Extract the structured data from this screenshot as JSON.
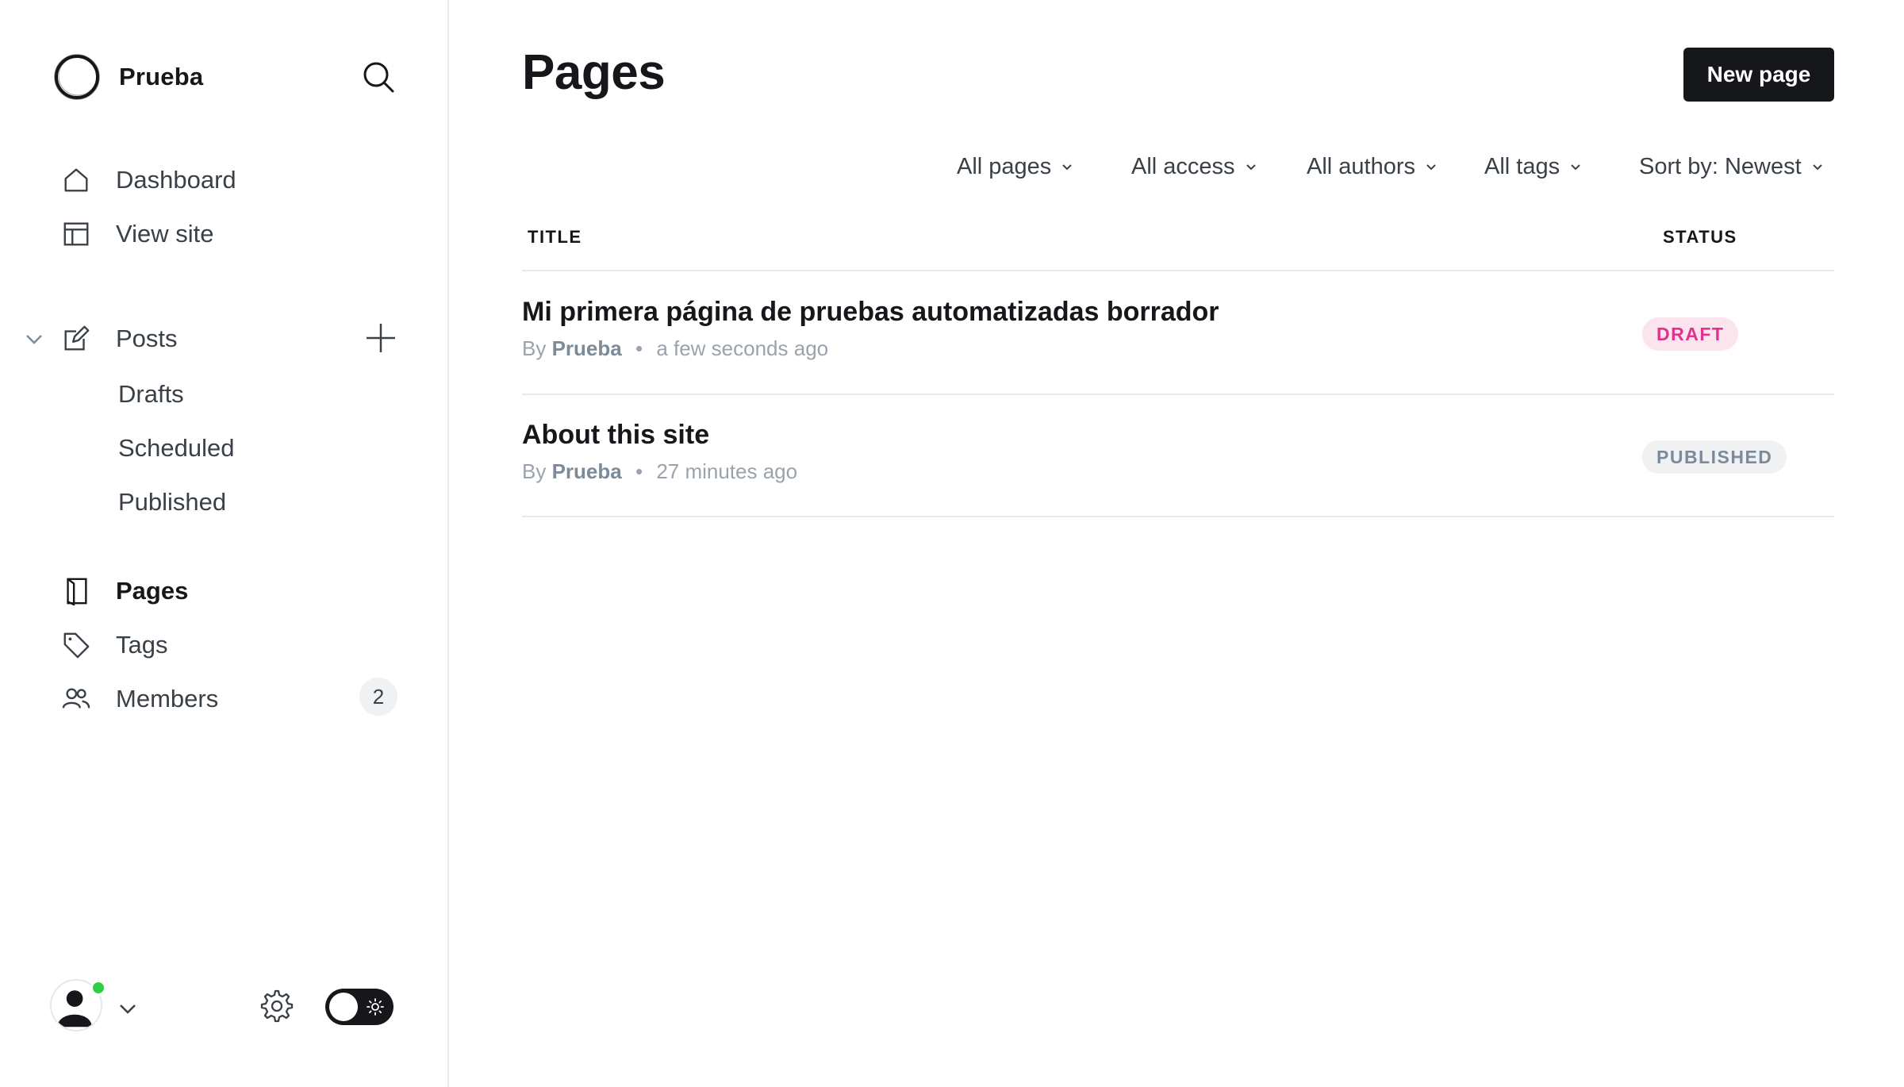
{
  "sidebar": {
    "brand": {
      "name": "Prueba"
    },
    "nav_top": [
      {
        "label": "Dashboard",
        "icon": "home-icon"
      },
      {
        "label": "View site",
        "icon": "layout-icon"
      }
    ],
    "posts": {
      "label": "Posts",
      "icon": "edit-icon",
      "sub_items": [
        {
          "label": "Drafts"
        },
        {
          "label": "Scheduled"
        },
        {
          "label": "Published"
        }
      ]
    },
    "nav_bottom": [
      {
        "label": "Pages",
        "icon": "page-icon",
        "active": true
      },
      {
        "label": "Tags",
        "icon": "tag-icon"
      },
      {
        "label": "Members",
        "icon": "members-icon",
        "count": "2"
      }
    ],
    "footer": {
      "status_color": "#30cf43",
      "theme_toggle_state": "dark"
    }
  },
  "main": {
    "title": "Pages",
    "new_button": "New page",
    "filters": [
      {
        "label": "All pages"
      },
      {
        "label": "All access"
      },
      {
        "label": "All authors"
      },
      {
        "label": "All tags"
      },
      {
        "label": "Sort by: Newest"
      }
    ],
    "columns": {
      "title": "TITLE",
      "status": "STATUS"
    },
    "rows": [
      {
        "title": "Mi primera página de pruebas automatizadas borrador",
        "by": "By",
        "author": "Prueba",
        "separator": "•",
        "time": "a few seconds ago",
        "status": "DRAFT"
      },
      {
        "title": "About this site",
        "by": "By",
        "author": "Prueba",
        "separator": "•",
        "time": "27 minutes ago",
        "status": "PUBLISHED"
      }
    ]
  },
  "colors": {
    "primary": "#15171a",
    "draft_bg": "#fce4ee",
    "draft_text": "#e0338c",
    "published_bg": "#eff1f3",
    "published_text": "#7c8b9a",
    "online": "#30cf43"
  }
}
